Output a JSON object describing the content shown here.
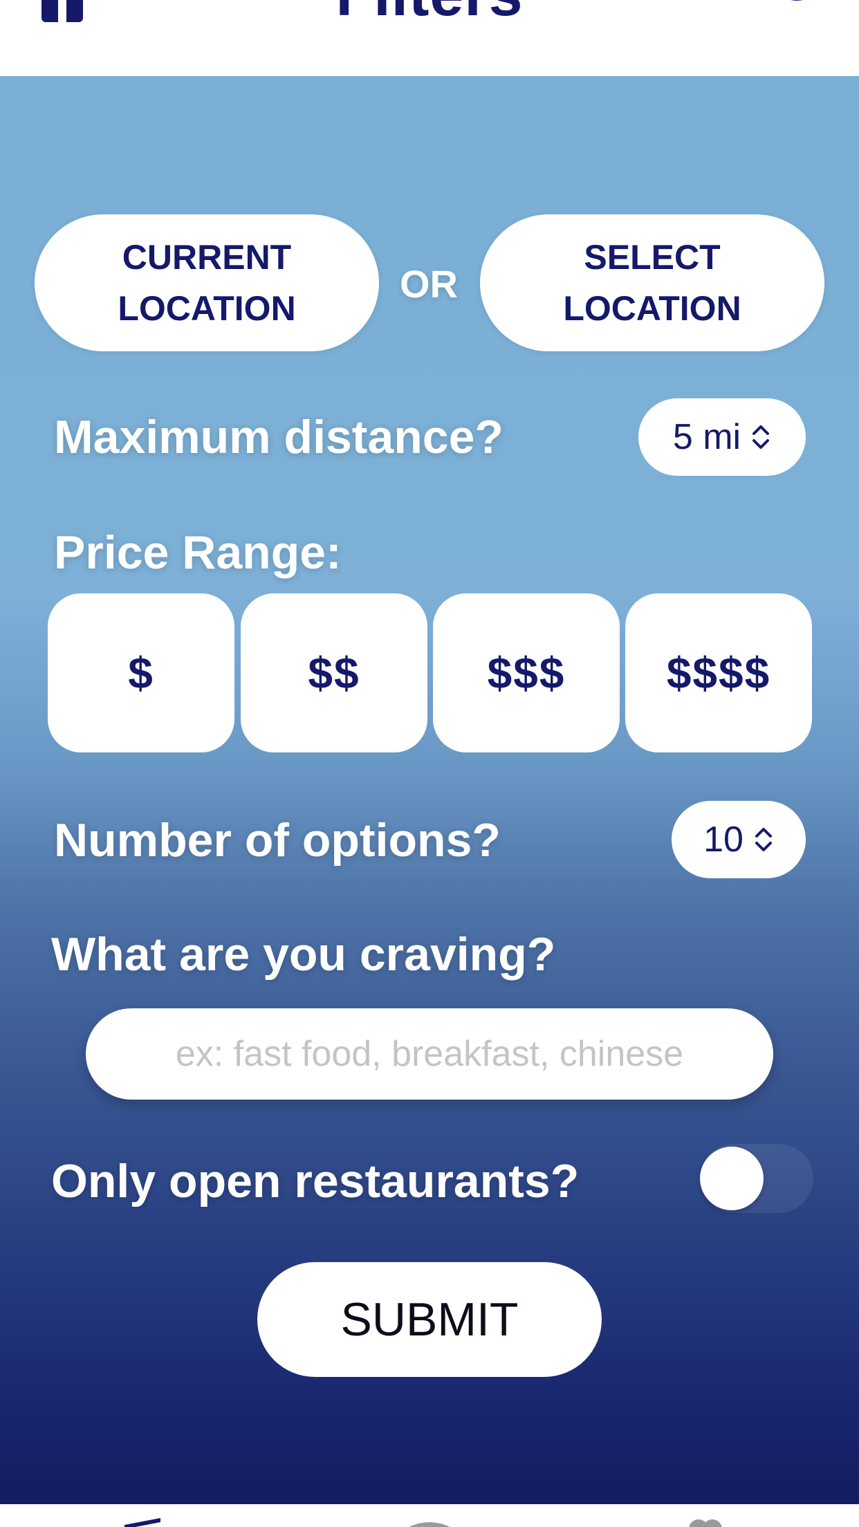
{
  "header": {
    "title": "Filters",
    "left_icon": "trash-icon",
    "right_icon": "info-icon"
  },
  "location": {
    "current_label": "CURRENT LOCATION",
    "or_label": "OR",
    "select_label": "SELECT LOCATION"
  },
  "distance": {
    "label": "Maximum distance?",
    "value": "5 mi"
  },
  "price": {
    "label": "Price Range:",
    "options": [
      "$",
      "$$",
      "$$$",
      "$$$$"
    ]
  },
  "options": {
    "label": "Number of options?",
    "value": "10"
  },
  "craving": {
    "label": "What are you craving?",
    "placeholder": "ex: fast food, breakfast, chinese",
    "value": ""
  },
  "open_only": {
    "label": "Only open restaurants?",
    "enabled": false
  },
  "submit_label": "SUBMIT",
  "tabbar": {
    "icons": [
      "filters-tab-icon",
      "chat-tab-icon",
      "favorites-tab-icon"
    ]
  },
  "colors": {
    "navy": "#14196a",
    "gradient_top": "#7aaed4",
    "gradient_bottom": "#141c62",
    "white": "#ffffff",
    "placeholder": "#c4c4c4"
  }
}
